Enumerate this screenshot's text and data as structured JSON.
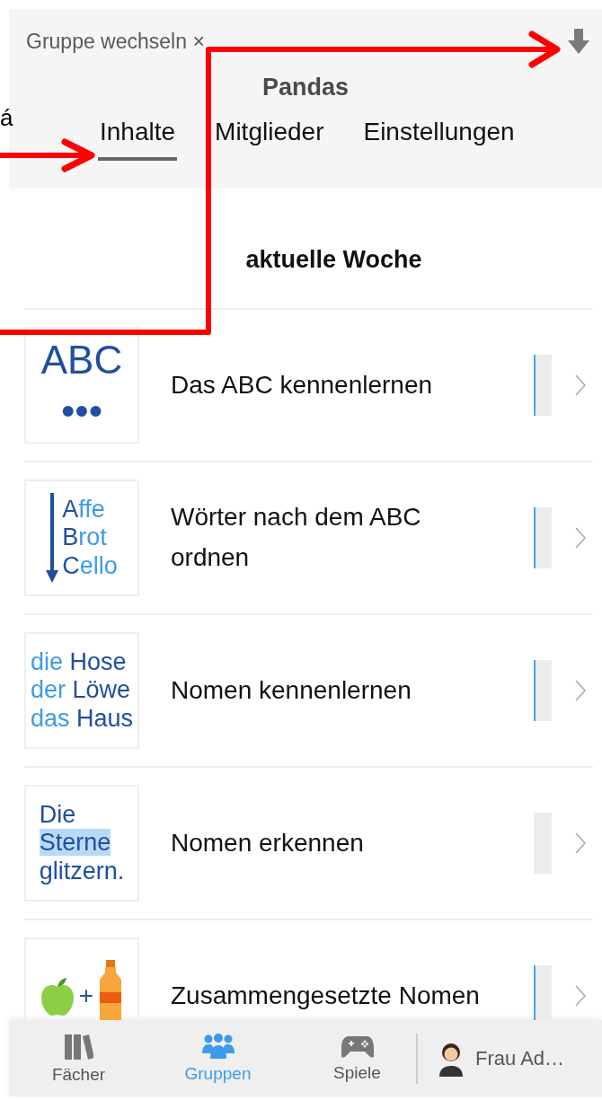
{
  "header": {
    "switch_group": "Gruppe wechseln ×",
    "title": "Pandas",
    "tabs": [
      {
        "label": "Inhalte",
        "selected": true
      },
      {
        "label": "Mitglieder",
        "selected": false
      },
      {
        "label": "Einstellungen",
        "selected": false
      }
    ]
  },
  "section": {
    "title": "aktuelle Woche"
  },
  "units": [
    {
      "title": "Das ABC kennenlernen",
      "started": true,
      "thumbnail": {
        "kind": "text",
        "lines": [
          [
            {
              "text": "ABC",
              "color": "#1f4fa0",
              "highlighted": false
            }
          ],
          [
            {
              "text": "•••",
              "color": "#1f4fa0",
              "highlighted": false
            }
          ]
        ]
      }
    },
    {
      "title": "Wörter nach dem ABC ordnen",
      "started": true,
      "thumbnail": {
        "kind": "arrow-list",
        "lines": [
          [
            {
              "text": "A",
              "color": "#1f4fa0",
              "highlighted": false
            },
            {
              "text": "ffe",
              "color": "#3d9be9",
              "highlighted": false
            }
          ],
          [
            {
              "text": "B",
              "color": "#1f4fa0",
              "highlighted": false
            },
            {
              "text": "rot",
              "color": "#3d9be9",
              "highlighted": false
            }
          ],
          [
            {
              "text": "C",
              "color": "#1f4fa0",
              "highlighted": false
            },
            {
              "text": "ello",
              "color": "#3d9be9",
              "highlighted": false
            }
          ]
        ]
      }
    },
    {
      "title": "Nomen kennenlernen",
      "started": true,
      "thumbnail": {
        "kind": "text",
        "lines": [
          [
            {
              "text": "die ",
              "color": "#3d9be9",
              "highlighted": false
            },
            {
              "text": "Hose",
              "color": "#1f4fa0",
              "highlighted": false
            }
          ],
          [
            {
              "text": "der ",
              "color": "#3d9be9",
              "highlighted": false
            },
            {
              "text": "Löwe",
              "color": "#1f4fa0",
              "highlighted": false
            }
          ],
          [
            {
              "text": "das ",
              "color": "#3d9be9",
              "highlighted": false
            },
            {
              "text": "Haus",
              "color": "#1f4fa0",
              "highlighted": false
            }
          ]
        ]
      }
    },
    {
      "title": "Nomen erkennen",
      "started": false,
      "thumbnail": {
        "kind": "text",
        "lines": [
          [
            {
              "text": "Die",
              "color": "#1f4fa0",
              "highlighted": false
            }
          ],
          [
            {
              "text": "Sterne",
              "color": "#1f4fa0",
              "highlighted": true
            }
          ],
          [
            {
              "text": "glitzern.",
              "color": "#1f4fa0",
              "highlighted": false
            }
          ]
        ]
      }
    },
    {
      "title": "Zusammengesetzte Nomen",
      "started": true,
      "thumbnail": {
        "kind": "sum",
        "lines": [
          [
            {
              "text": "+",
              "color": "#1f4fa0",
              "highlighted": false
            }
          ]
        ]
      }
    }
  ],
  "bottom_nav": {
    "items": [
      {
        "label": "Fächer",
        "selected": false
      },
      {
        "label": "Gruppen",
        "selected": true
      },
      {
        "label": "Spiele",
        "selected": false
      }
    ],
    "profile": {
      "name": "Frau Ad…"
    }
  },
  "annotation": {
    "text": "á"
  }
}
